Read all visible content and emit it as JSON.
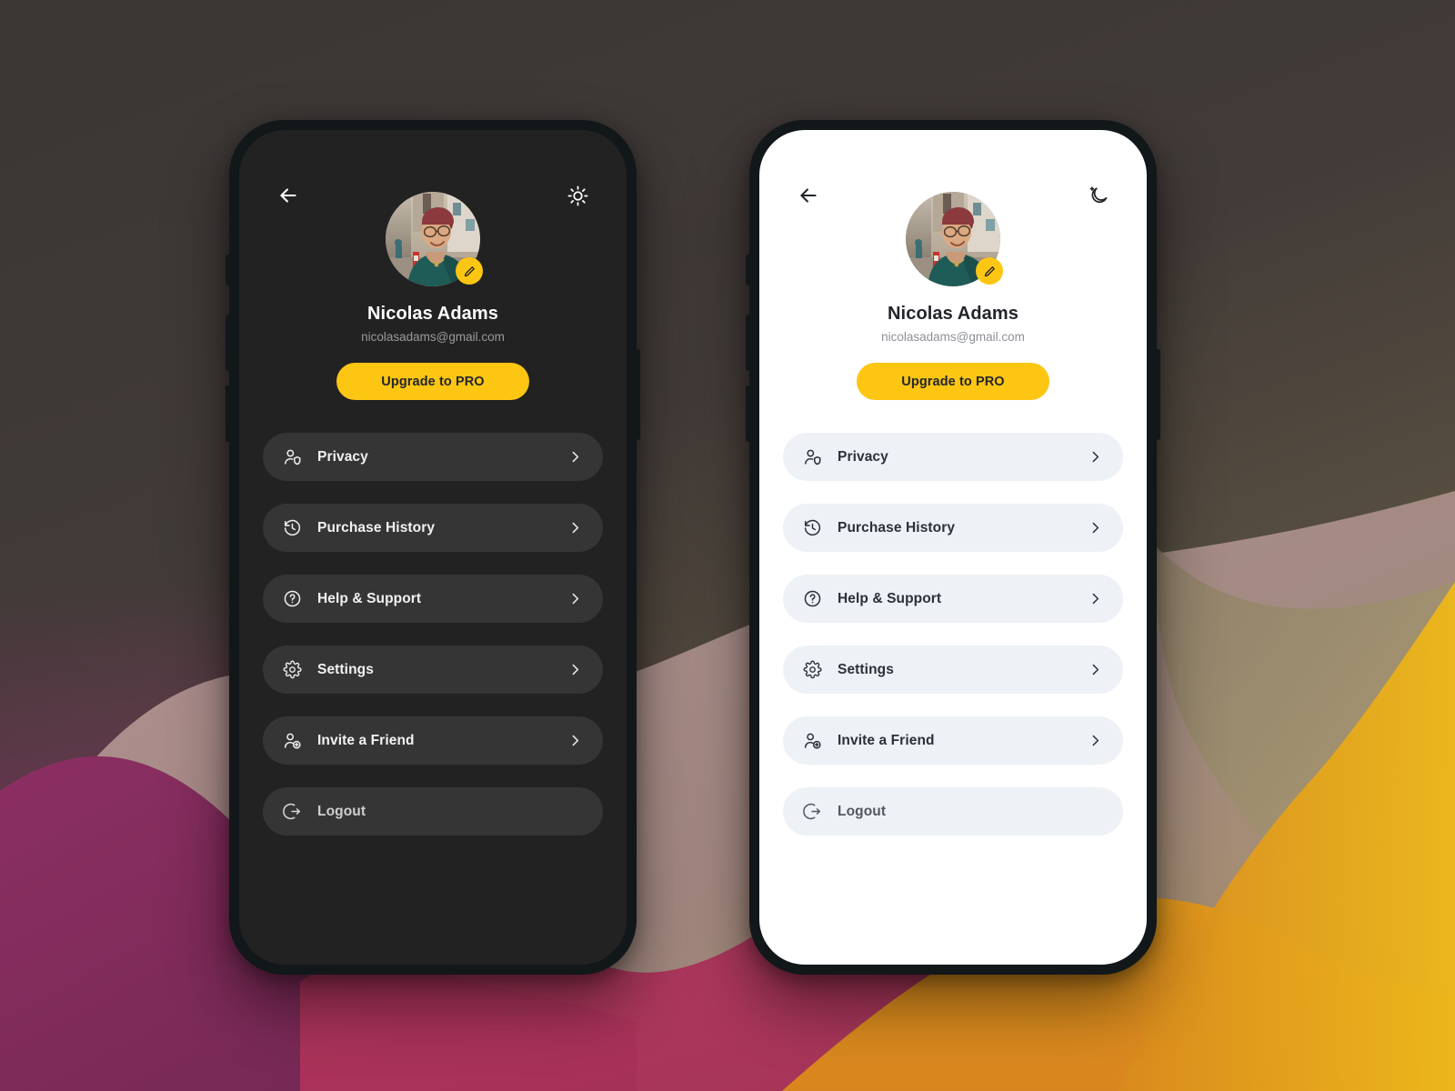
{
  "background": {
    "top_color": "#3a3634",
    "purple": "#7d2a5f",
    "crimson": "#b0335c",
    "mauve": "#b08f92",
    "tan": "#a08a6d",
    "orange": "#e08a1e",
    "amber": "#eab61c"
  },
  "theme": {
    "accent": "#fcc613",
    "dark_screen_bg": "#222222",
    "light_screen_bg": "#ffffff",
    "dark_row_bg": "#353535",
    "light_row_bg": "#eef1f6",
    "frame": "#12171a"
  },
  "phones": [
    {
      "id": "dark",
      "mode_label": "dark",
      "topbar": {
        "back_icon": "arrow-left-icon",
        "theme_toggle_icon": "sun-icon"
      },
      "profile": {
        "avatar_alt": "user-avatar",
        "edit_icon": "pencil-icon",
        "name": "Nicolas Adams",
        "email": "nicolasadams@gmail.com",
        "upgrade_label": "Upgrade to PRO"
      },
      "menu": [
        {
          "label": "Privacy",
          "icon": "person-shield-icon",
          "chevron": true,
          "muted": false
        },
        {
          "label": "Purchase History",
          "icon": "clock-history-icon",
          "chevron": true,
          "muted": false
        },
        {
          "label": "Help & Support",
          "icon": "question-circle-icon",
          "chevron": true,
          "muted": false
        },
        {
          "label": "Settings",
          "icon": "gear-icon",
          "chevron": true,
          "muted": false
        },
        {
          "label": "Invite a Friend",
          "icon": "person-plus-icon",
          "chevron": true,
          "muted": false
        },
        {
          "label": "Logout",
          "icon": "logout-icon",
          "chevron": false,
          "muted": true
        }
      ]
    },
    {
      "id": "light",
      "mode_label": "light",
      "topbar": {
        "back_icon": "arrow-left-icon",
        "theme_toggle_icon": "moon-sparkle-icon"
      },
      "profile": {
        "avatar_alt": "user-avatar",
        "edit_icon": "pencil-icon",
        "name": "Nicolas Adams",
        "email": "nicolasadams@gmail.com",
        "upgrade_label": "Upgrade to PRO"
      },
      "menu": [
        {
          "label": "Privacy",
          "icon": "person-shield-icon",
          "chevron": true,
          "muted": false
        },
        {
          "label": "Purchase History",
          "icon": "clock-history-icon",
          "chevron": true,
          "muted": false
        },
        {
          "label": "Help & Support",
          "icon": "question-circle-icon",
          "chevron": true,
          "muted": false
        },
        {
          "label": "Settings",
          "icon": "gear-icon",
          "chevron": true,
          "muted": false
        },
        {
          "label": "Invite a Friend",
          "icon": "person-plus-icon",
          "chevron": true,
          "muted": false
        },
        {
          "label": "Logout",
          "icon": "logout-icon",
          "chevron": false,
          "muted": true
        }
      ]
    }
  ]
}
